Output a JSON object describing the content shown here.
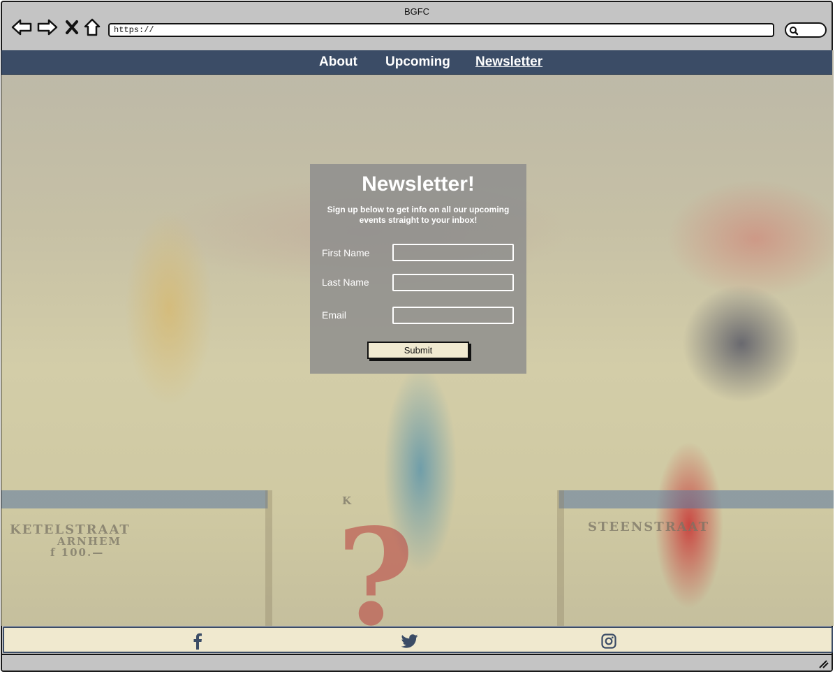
{
  "browser": {
    "window_title": "BGFC",
    "url": "https://",
    "buttons": [
      "back",
      "forward",
      "stop",
      "home"
    ]
  },
  "nav": {
    "items": [
      {
        "label": "About",
        "active": false
      },
      {
        "label": "Upcoming",
        "active": false
      },
      {
        "label": "Newsletter",
        "active": true
      }
    ],
    "bg_color": "#3b4c66"
  },
  "newsletter": {
    "title": "Newsletter!",
    "subtitle": "Sign up below to get info on all our upcoming events straight to your inbox!",
    "fields": [
      {
        "label": "First Name",
        "value": ""
      },
      {
        "label": "Last Name",
        "value": ""
      },
      {
        "label": "Email",
        "value": ""
      }
    ],
    "submit_label": "Submit"
  },
  "footer": {
    "social": [
      "facebook-icon",
      "twitter-icon",
      "instagram-icon"
    ],
    "bg_color": "#f0e9cf"
  },
  "background_image": {
    "board_text_left": [
      "KETELSTRAAT",
      "ARNHEM",
      "f 100.—"
    ],
    "board_text_right": [
      "STEENSTRAAT"
    ],
    "board_letter": "K"
  }
}
